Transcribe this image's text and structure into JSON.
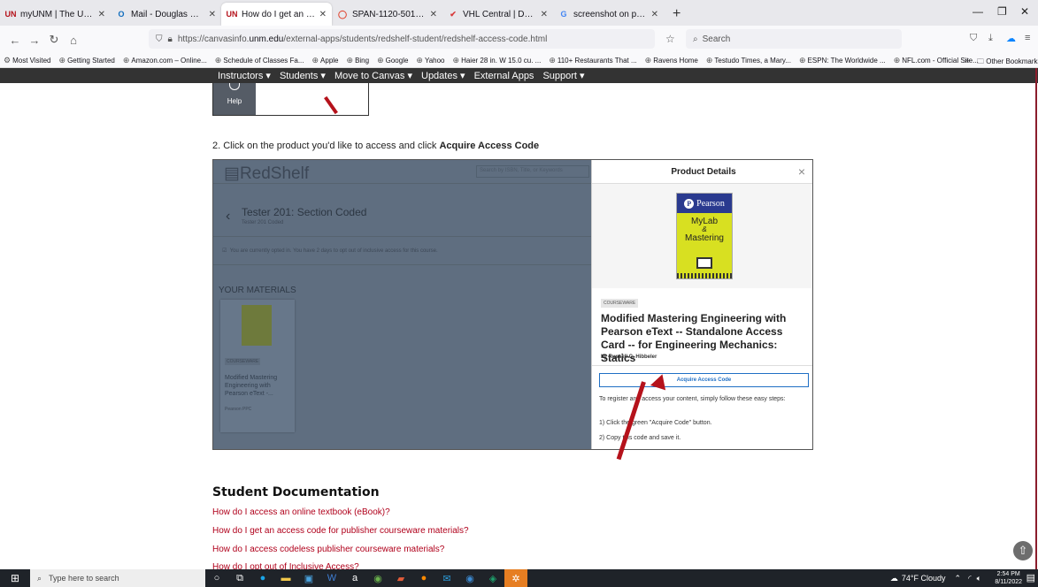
{
  "browser": {
    "tabs": [
      {
        "title": "myUNM | The University of New",
        "icon": "unm-logo",
        "color": "#b5121b",
        "glyph": "UN"
      },
      {
        "title": "Mail - Douglas Deane - Outlook",
        "icon": "outlook-icon",
        "color": "#0f6cbd",
        "glyph": "O"
      },
      {
        "title": "How do I get an access code fo",
        "icon": "unm-logo",
        "color": "#b5121b",
        "glyph": "UN",
        "active": true
      },
      {
        "title": "SPAN-1120-501 Fall 2022",
        "icon": "canvas-icon",
        "color": "#e0402a",
        "glyph": "◯"
      },
      {
        "title": "VHL Central | Dashboard",
        "icon": "vhl-icon",
        "color": "#d83a3a",
        "glyph": "✔"
      },
      {
        "title": "screenshot on pc - Google Sea",
        "icon": "google-icon",
        "color": "#4285f4",
        "glyph": "G"
      }
    ],
    "new_tab": "+",
    "url_prefix": "https://canvasinfo.",
    "url_domain": "unm.edu",
    "url_rest": "/external-apps/students/redshelf-student/redshelf-access-code.html",
    "search_placeholder": "Search",
    "bookmarks": [
      "Most Visited",
      "Getting Started",
      "Amazon.com – Online...",
      "Schedule of Classes Fa...",
      "Apple",
      "Bing",
      "Google",
      "Yahoo",
      "Haier 28 in. W 15.0 cu. ...",
      "110+ Restaurants That ...",
      "Ravens Home",
      "Testudo Times, a Mary...",
      "ESPN: The Worldwide ...",
      "NFL.com - Official Site..."
    ],
    "other_bookmarks": "Other Bookmarks"
  },
  "site_nav": [
    "Instructors ▾",
    "Students ▾",
    "Move to Canvas ▾",
    "Updates ▾",
    "External Apps",
    "Support ▾"
  ],
  "help_label": "Help",
  "step2": {
    "prefix": "2. Click on the product you'd like to access and click ",
    "bold": "Acquire Access Code"
  },
  "redshelf": {
    "logo": "RedShelf",
    "search_placeholder": "Search by ISBN, Title, or Keywords",
    "course_title": "Tester 201: Section Coded",
    "course_sub": "Tester 201 Coded",
    "optin_note": "You are currently opted in. You have 2 days to opt out of inclusive access for this course.",
    "materials_heading": "YOUR MATERIALS",
    "card_tag": "COURSEWARE",
    "card_title": "Modified Mastering Engineering with Pearson eText -...",
    "card_publisher": "Pearson PPC"
  },
  "panel": {
    "heading": "Product Details",
    "close": "×",
    "pearson": "Pearson",
    "pearson_glyph": "P",
    "mylab_line1": "MyLab",
    "mylab_amp": "&",
    "mylab_line2": "Mastering",
    "tag": "COURSEWARE",
    "title": "Modified Mastering Engineering with Pearson eText -- Standalone Access Card -- for Engineering Mechanics: Statics",
    "author": "by Russell C. Hibbeler",
    "acquire_button": "Acquire Access Code",
    "instructions": "To register and access your content, simply follow these easy steps:",
    "step1": "1) Click the green \"Acquire Code\" button.",
    "step2": "2) Copy this code and save it."
  },
  "student_docs": {
    "title": "Student Documentation",
    "links": [
      "How do I access an online textbook (eBook)?",
      "How do I get an access code for publisher courseware materials?",
      "How do I access codeless publisher courseware materials?",
      "How do I opt out of Inclusive Access?"
    ]
  },
  "taskbar": {
    "search_placeholder": "Type here to search",
    "weather": "74°F  Cloudy",
    "time": "2:54 PM",
    "date": "8/11/2022"
  }
}
